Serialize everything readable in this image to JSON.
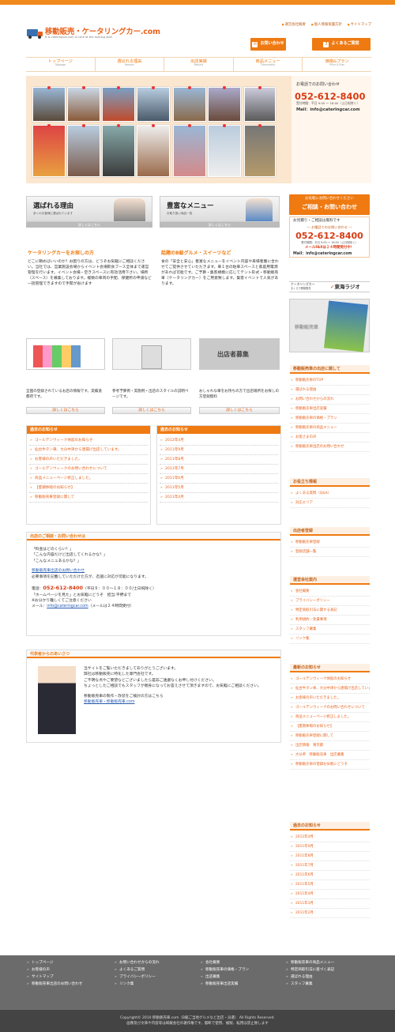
{
  "header": {
    "logo_title": "移動販売・ケータリングカー.com",
    "logo_sub": "It is cateringcar.com in care of the moving stall",
    "top_links": [
      "運営会社概要",
      "個人情報保護方針",
      "サイトマップ"
    ],
    "contact_btn": "お問い合わせ",
    "faq_btn": "よくあるご質問"
  },
  "nav": [
    {
      "jp": "トップページ",
      "en": "Toppage"
    },
    {
      "jp": "選ばれる理由",
      "en": "Reason"
    },
    {
      "jp": "出店実績",
      "en": "Results"
    },
    {
      "jp": "商品メニュー",
      "en": "Commodity"
    },
    {
      "jp": "価格&プラン",
      "en": "Price & Plan"
    }
  ],
  "hero": {
    "phone_intro": "お電話でのお問い合わせ",
    "phone": "052-612-8400",
    "hours": "受付時間：平日 9:00 〜 18:00（土日祝除く）",
    "mail": "Mail：info@cateringcar.com"
  },
  "cards": [
    {
      "title": "選ばれる理由",
      "sub": "多くのお客様に選ばれています",
      "more": "詳しくはこちら",
      "heading": "ケータリングカーをお探しの方",
      "text": "どこに頼めばいいのか？お困りの方は、どうぞお気軽にご相談ください。当社では、営業施設会場からイベント会場飲食ブース全体まで運営管理を行います。イベント会場・空きスペースに有効活用下さい。場所（スペース）を募集しております。複数の車両の手配、保健所の申請など一括管理できますので手間が省けます"
    },
    {
      "title": "豊富なメニュー",
      "sub": "お取り扱い商品一覧",
      "more": "詳しくはこちら",
      "heading": "話題のB級グルメ・スイーツなど",
      "text": "食の「安全と安心」豊富なメニューをイベント内容や来場者層に合わせてご提供させていただきます。車１台の駐車スペースと家庭用電源があれば可能です。ご予算・集客規模に応じてテント形式・移動販売車（ケータリングカー）をご用意致します。集客イベントで人気があります。"
    }
  ],
  "side_contact": {
    "title1": "お気軽にお問い合わせください",
    "title2": "ご相談・お問い合わせ",
    "note": "お見積り・ご相談は無料です",
    "phone_intro": "― お電話でのお問い合わせ ―",
    "phone": "052-612-8400",
    "hours": "受付時間：平日 9:00 〜 18:00（土日祝除く）",
    "fax": "メールFAXは２４時間受付中！",
    "mail": "Mail：info@cateringcar.com"
  },
  "radio": {
    "label1": "ケータリングカー",
    "label2": "まくらで移動販売",
    "brand": "東海ラジオ"
  },
  "book": {
    "label": "移動販売車"
  },
  "thumbs": [
    {
      "title": "",
      "text": "全国の登録されているお店の情報です。実績道都府です。",
      "btn": "詳しくはこちら"
    },
    {
      "title": "",
      "text": "参考予算例・実施例・出店のスタイルの説明ページです。",
      "btn": "詳しくはこちら"
    },
    {
      "title": "出店者募集",
      "text": "おしゃれな車をお持ちの方で出店場所をお探しの方登録無料",
      "btn": "詳しくはこちら"
    }
  ],
  "news_left": {
    "title": "過去のお知らせ",
    "items": [
      "ゴールデンウィーク休館のお知らせ",
      "仙台牛タン車、大分中津から唐揚げ出店しています。",
      "お客様の声いただきました。",
      "ゴールデンウィークのお問い合わせについて",
      "商品メニューページ修正しました。",
      "【夏期休暇のお知らせ】",
      "移動販売車登録に関して"
    ]
  },
  "news_right": {
    "title": "過去のお知らせ",
    "items": [
      "2012年4月",
      "2011年9月",
      "2011年8月",
      "2011年7月",
      "2011年6月",
      "2011年5月",
      "2011年4月"
    ]
  },
  "contact_box": {
    "title": "出店のご相談・お問い合わせは",
    "q1": "「料金はどのくらい？」",
    "q2": "「こんな内容だけど出店してくれるかな？」",
    "q3": "「こんなメニュあるかな？」",
    "link": "移動販売車出店のお問い合わせ",
    "line1": "必要事項を記載していただけた方が、迅速に対応が可能になります。",
    "tel_label": "電話：",
    "tel": "052-612-8400",
    "tel_hours": "（平日９：００〜１８：００/土日祝除く）",
    "line2": "「ホームページを見た」とお気軽にどうぞ　担当:平野まで",
    "line3": "※お分かり難しくてご注意ください",
    "mail_label": "メール：",
    "mail": "info@cateringcar.com",
    "mail_note": "（メールは２４時間受付）"
  },
  "greeting": {
    "title": "代表者からのあいさつ",
    "p1": "当サイトをご覧いただきましてありがとうございます。",
    "p2": "弊社は移動販売に特化した専門会社です。",
    "p3": "ご不明な点やご要望などございましたら是非ご遠慮なくお申し付けください。",
    "p4": "ちょっとしたご相談でもスタッフが親身になってお答えさせて頂きますので、お気軽にご相談ください。",
    "p5": "移動販売車の製作・改装をご検討の方はこちら",
    "link": "移動販売車・移動販売車.com"
  },
  "sidebar": {
    "sec1": {
      "title": "移動販売車の出店に関して",
      "items": [
        "移動販売車のTOP",
        "選ばれる理由",
        "お問い合わせからの流れ",
        "移動販売車出店実績",
        "移動販売車の価格・プラン",
        "移動販売車の商品メニュー",
        "お客さまの声",
        "移動販売車出店のお問い合わせ"
      ]
    },
    "sec2": {
      "title": "お役立ち情報",
      "items": [
        "よくある質問（Q&A）",
        "対応エリア"
      ]
    },
    "sec3": {
      "title": "出店者登録",
      "items": [
        "移動販売車登録",
        "登録店舗一覧"
      ]
    },
    "sec4": {
      "title": "運営会社案内",
      "items": [
        "会社概要",
        "プライバシーポリシー",
        "特定商取引法に関する表記",
        "利用規約・免責事項",
        "スタッフ募集",
        "リンク集"
      ]
    },
    "sec5": {
      "title": "最新のお知らせ",
      "items": [
        "ゴールデンウィーク休館のお知らせ",
        "仙台牛タン車、大分中津から唐揚げ出店しています。",
        "お客様の声いただきました。",
        "ゴールデンウィークのお問い合わせについて",
        "商品メニューページ修正しました。",
        "【夏期休暇のお知らせ】",
        "移動販売車登録に関して",
        "出店情報　東京都",
        "大分県　移動販売車　出店募集",
        "移動販売車の登録お気軽にどうぞ"
      ]
    },
    "sec6": {
      "title": "過去のお知らせ",
      "items": [
        "2012年4月",
        "2011年9月",
        "2011年8月",
        "2011年7月",
        "2011年6月",
        "2011年5月",
        "2011年4月",
        "2011年3月",
        "2011年2月"
      ]
    }
  },
  "footer": {
    "cols": [
      [
        "トップページ",
        "お客様の声",
        "サイトマップ",
        "移動販売車出店のお問い合わせ"
      ],
      [
        "お問い合わせからの流れ",
        "よくあるご質問",
        "プライバシーポリシー",
        "リンク集"
      ],
      [
        "会社概要",
        "移動販売車の価格・プラン",
        "出店募集",
        "移動販売車出店実績"
      ],
      [
        "移動販売車の商品メニュー",
        "特定商取引法に基づく表記",
        "選ばれる理由",
        "スタッフ募集"
      ]
    ],
    "copy1": "Copyright© 2010 移動販売車.com（B級ご当地グルメなど出店・派遣） All Rights Reserved.",
    "copy2": "画像及び文章や内容等は掲載会社の著作権です。無断で使用、複製、転用は禁止致します"
  },
  "colors": {
    "accent": "#ef7a12",
    "brand": "#e9621b",
    "phone": "#d83c14"
  }
}
